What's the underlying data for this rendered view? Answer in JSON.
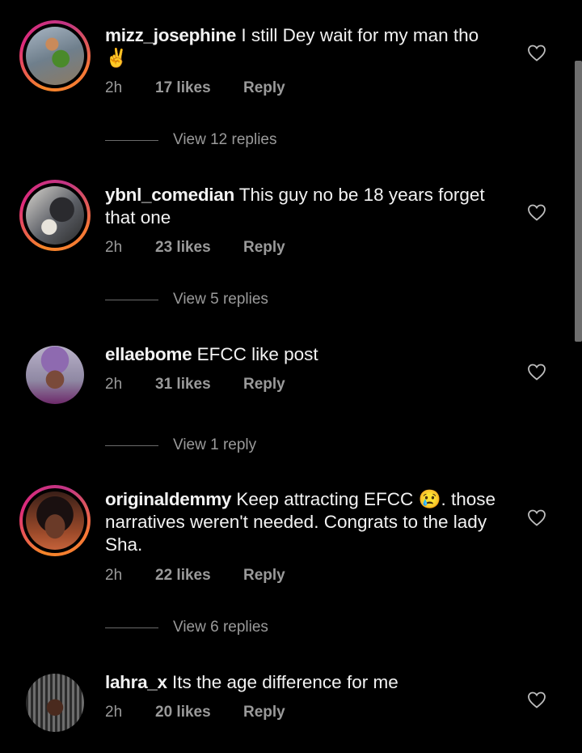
{
  "comments": [
    {
      "username": "mizz_josephine",
      "text": " I still Dey wait for my man tho ✌️",
      "time": "2h",
      "likes": "17 likes",
      "reply_label": "Reply",
      "view_replies": "View 12 replies",
      "story_ring": true
    },
    {
      "username": "ybnl_comedian",
      "text": " This guy no be 18 years forget that one",
      "time": "2h",
      "likes": "23 likes",
      "reply_label": "Reply",
      "view_replies": "View 5 replies",
      "story_ring": true
    },
    {
      "username": "ellaebome",
      "text": " EFCC like post",
      "time": "2h",
      "likes": "31 likes",
      "reply_label": "Reply",
      "view_replies": "View 1 reply",
      "story_ring": false
    },
    {
      "username": "originaldemmy",
      "text": " Keep attracting EFCC 😢. those narratives weren't needed. Congrats to the lady Sha.",
      "time": "2h",
      "likes": "22 likes",
      "reply_label": "Reply",
      "view_replies": "View 6 replies",
      "story_ring": true
    },
    {
      "username": "lahra_x",
      "text": " Its the age difference for me",
      "time": "2h",
      "likes": "20 likes",
      "reply_label": "Reply",
      "story_ring": false
    }
  ],
  "icons": {
    "like": "heart-outline-icon"
  },
  "colors": {
    "background": "#000000",
    "secondary_text": "#9a9a9a",
    "ring_start": "#f58529",
    "ring_end": "#dd2a7b"
  }
}
